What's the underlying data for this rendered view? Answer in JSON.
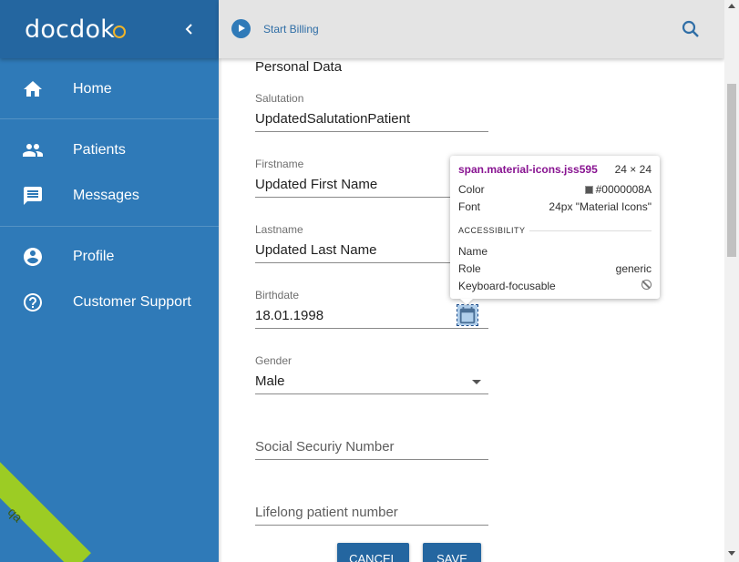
{
  "sidebar": {
    "logo": "docdok",
    "items": [
      {
        "label": "Home",
        "icon": "home-icon"
      },
      {
        "label": "Patients",
        "icon": "people-icon"
      },
      {
        "label": "Messages",
        "icon": "message-icon"
      },
      {
        "label": "Profile",
        "icon": "account-circle-icon"
      },
      {
        "label": "Customer Support",
        "icon": "help-icon"
      }
    ],
    "env_badge": "qa"
  },
  "topbar": {
    "start_billing": "Start Billing",
    "search_icon": "search-icon"
  },
  "form": {
    "section_title": "Personal Data",
    "salutation": {
      "label": "Salutation",
      "value": "UpdatedSalutationPatient"
    },
    "firstname": {
      "label": "Firstname",
      "value": "Updated First Name"
    },
    "lastname": {
      "label": "Lastname",
      "value": "Updated Last Name"
    },
    "birthdate": {
      "label": "Birthdate",
      "value": "18.01.1998"
    },
    "gender": {
      "label": "Gender",
      "value": "Male"
    },
    "ssn": {
      "placeholder": "Social Securiy Number"
    },
    "lifelong": {
      "placeholder": "Lifelong patient number"
    },
    "cancel": "CANCEL",
    "save": "SAVE"
  },
  "inspector": {
    "selector": "span.material-icons.jss595",
    "dims": "24 × 24",
    "color_label": "Color",
    "color_value": "#0000008A",
    "font_label": "Font",
    "font_value": "24px \"Material Icons\"",
    "section": "ACCESSIBILITY",
    "name_label": "Name",
    "name_value": "",
    "role_label": "Role",
    "role_value": "generic",
    "keyboard_label": "Keyboard-focusable"
  },
  "colors": {
    "sidebar": "#2f7ab8",
    "sidebar_header": "#2466a0",
    "accent": "#2466a0",
    "qa_badge": "#9ccc24"
  }
}
